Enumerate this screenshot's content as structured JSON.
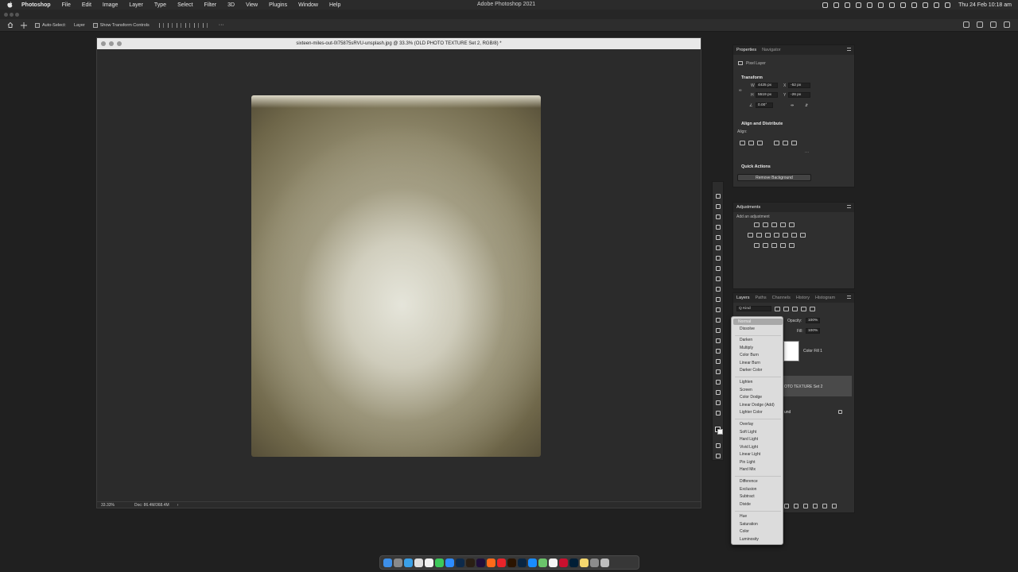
{
  "menubar": {
    "app": "Photoshop",
    "items": [
      "File",
      "Edit",
      "Image",
      "Layer",
      "Type",
      "Select",
      "Filter",
      "3D",
      "View",
      "Plugins",
      "Window",
      "Help"
    ],
    "window_title": "Adobe Photoshop 2021",
    "clock": "Thu 24 Feb  10:18 am"
  },
  "options": {
    "auto_select_label": "Auto-Select:",
    "auto_select_value": "Layer",
    "transform_label": "Show Transform Controls",
    "more": "···"
  },
  "document": {
    "title": "sixteen-miles-out-0I75875sRVU-unsplash.jpg @ 33.3% (OLD PHOTO TEXTURE Set 2, RGB/8) *",
    "zoom": "33.33%",
    "doc_size": "Doc: 86.4M/368.4M"
  },
  "properties": {
    "tabs": [
      "Properties",
      "Navigator"
    ],
    "layer_kind": "Pixel Layer",
    "transform_title": "Transform",
    "w_label": "W",
    "w_value": "4425 px",
    "h_label": "H",
    "h_value": "5519 px",
    "x_label": "X",
    "x_value": "-52 px",
    "y_label": "Y",
    "y_value": "-26 px",
    "angle_value": "0.00°",
    "align_title": "Align and Distribute",
    "align_label": "Align:",
    "dots": "···",
    "quick_actions_title": "Quick Actions",
    "remove_bg_button": "Remove Background"
  },
  "adjustments": {
    "title": "Adjustments",
    "subtitle": "Add an adjustment"
  },
  "layers": {
    "tabs": [
      "Layers",
      "Paths",
      "Channels",
      "History",
      "Histogram"
    ],
    "filter_kind": "Q Kind",
    "opacity_label": "Opacity:",
    "opacity_value": "100%",
    "fill_label": "Fill:",
    "fill_value": "100%",
    "layer1_name": "Color Fill 1",
    "layer2_name": "OTO TEXTURE Set 2",
    "layer3_name": "und"
  },
  "blend_modes": {
    "current": "Normal",
    "groups": [
      [
        "Dissolve"
      ],
      [
        "Darken",
        "Multiply",
        "Color Burn",
        "Linear Burn",
        "Darker Color"
      ],
      [
        "Lighten",
        "Screen",
        "Color Dodge",
        "Linear Dodge (Add)",
        "Lighter Color"
      ],
      [
        "Overlay",
        "Soft Light",
        "Hard Light",
        "Vivid Light",
        "Linear Light",
        "Pin Light",
        "Hard Mix"
      ],
      [
        "Difference",
        "Exclusion",
        "Subtract",
        "Divide"
      ],
      [
        "Hue",
        "Saturation",
        "Color",
        "Luminosity"
      ]
    ]
  },
  "dock_apps": [
    "finder",
    "launchpad",
    "safari",
    "chrome",
    "calendar",
    "messages",
    "zoom",
    "photoshop",
    "bridge",
    "premiere",
    "firefox",
    "adobe-cc",
    "illustrator",
    "lightroom",
    "app-store",
    "maps",
    "photos",
    "acrobat",
    "photoshop-alt",
    "notes",
    "settings",
    "trash"
  ]
}
